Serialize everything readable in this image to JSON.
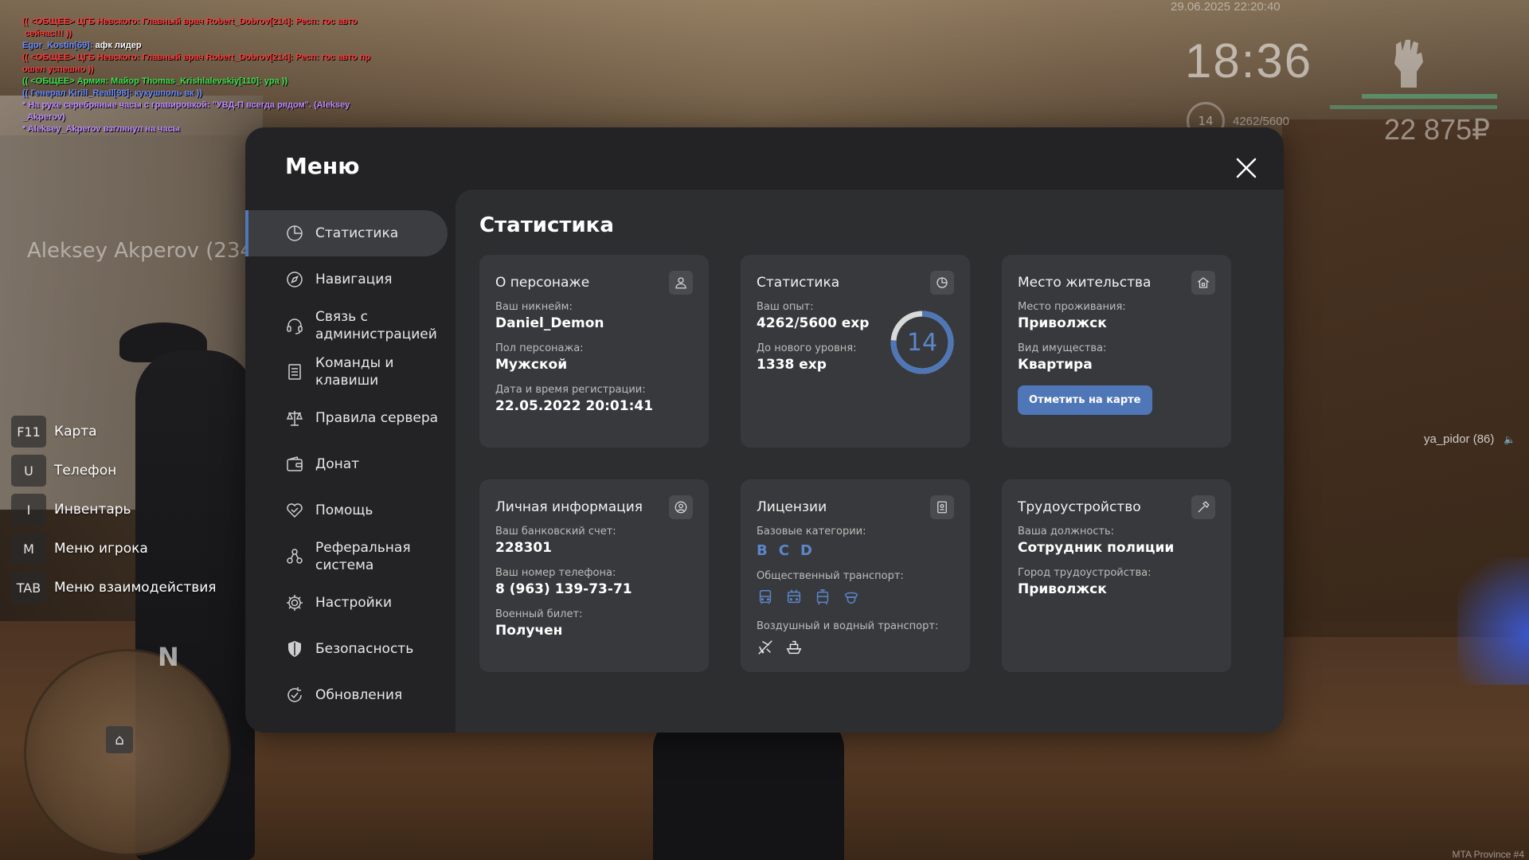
{
  "chat": [
    {
      "color": "red",
      "text": "(( <ОБЩЕЕ> ЦГБ Невского: Главный врач Robert_Dobrov[214]: Респ: гос авто\n сейчас!!! ))"
    },
    {
      "color": "blue",
      "text": "Egor_Kostin[69]:",
      "suffix": " афк лидер"
    },
    {
      "color": "red",
      "text": "(( <ОБЩЕЕ> ЦГБ Невского: Главный врач Robert_Dobrov[214]: Респ: гос авто пр\nошел успешно ))"
    },
    {
      "color": "green",
      "text": "(( <ОБЩЕЕ> Армия: Майор Thomas_Krishlalevskiy[110]: ура ))"
    },
    {
      "color": "blue",
      "text": "(( Генерал Kirill_Reall[98]: кукушполь вк ))"
    },
    {
      "color": "purple",
      "text": "* На руке серебряные часы с гравировкой: \"УВД-П всегда рядом\". (Aleksey\n_Akperov)"
    },
    {
      "color": "purple",
      "text": "* Aleksey_Akperov взглянул на часы"
    }
  ],
  "hud": {
    "datetime": "29.06.2025 22:20:40",
    "clock": "18:36",
    "money": "22 875₽",
    "level": "14",
    "exp": "4262/5600"
  },
  "nametag": "Aleksey Akperov (234",
  "player_tag": "ya_pidor (86)",
  "hints": [
    {
      "key": "F11",
      "label": "Карта"
    },
    {
      "key": "U",
      "label": "Телефон"
    },
    {
      "key": "I",
      "label": "Инвентарь"
    },
    {
      "key": "M",
      "label": "Меню игрока"
    },
    {
      "key": "TAB",
      "label": "Меню взаимодействия"
    }
  ],
  "minimap": {
    "north": "N"
  },
  "watermark": "MTA Province #4",
  "menu": {
    "title": "Меню",
    "sidebar": [
      {
        "label": "Статистика",
        "icon": "pie-chart-icon",
        "active": true
      },
      {
        "label": "Навигация",
        "icon": "compass-icon"
      },
      {
        "label": "Связь с\nадминистрацией",
        "icon": "headset-icon"
      },
      {
        "label": "Команды и\nклавиши",
        "icon": "document-list-icon"
      },
      {
        "label": "Правила сервера",
        "icon": "scales-icon"
      },
      {
        "label": "Донат",
        "icon": "wallet-icon"
      },
      {
        "label": "Помощь",
        "icon": "handshake-icon"
      },
      {
        "label": "Реферальная\nсистема",
        "icon": "people-network-icon"
      },
      {
        "label": "Настройки",
        "icon": "gear-icon"
      },
      {
        "label": "Безопасность",
        "icon": "shield-icon"
      },
      {
        "label": "Обновления",
        "icon": "refresh-check-icon"
      }
    ],
    "content_title": "Статистика",
    "cards": {
      "character": {
        "title": "О персонаже",
        "nickname_label": "Ваш никнейм:",
        "nickname": "Daniel_Demon",
        "gender_label": "Пол персонажа:",
        "gender": "Мужской",
        "reg_label": "Дата и время регистрации:",
        "reg": "22.05.2022 20:01:41"
      },
      "stats": {
        "title": "Статистика",
        "exp_label": "Ваш опыт:",
        "exp": "4262/5600 exp",
        "next_label": "До нового уровня:",
        "next": "1338 exp",
        "level": "14",
        "progress": 0.761
      },
      "residence": {
        "title": "Место жительства",
        "place_label": "Место проживания:",
        "place": "Приволжск",
        "property_label": "Вид имущества:",
        "property": "Квартира",
        "button": "Отметить на карте"
      },
      "personal": {
        "title": "Личная информация",
        "bank_label": "Ваш банковский счет:",
        "bank": "228301",
        "phone_label": "Ваш номер телефона:",
        "phone": "8 (963) 139-73-71",
        "military_label": "Военный билет:",
        "military": "Получен"
      },
      "licenses": {
        "title": "Лицензии",
        "base_label": "Базовые категории:",
        "categories": [
          "B",
          "C",
          "D"
        ],
        "public_label": "Общественный транспорт:",
        "public_icons": [
          "bus-icon",
          "trolleybus-icon",
          "tram-icon",
          "driver-cap-icon"
        ],
        "air_label": "Воздушный и водный транспорт:",
        "air_icons": [
          "airplane-icon",
          "boat-icon"
        ]
      },
      "job": {
        "title": "Трудоустройство",
        "position_label": "Ваша должность:",
        "position": "Сотрудник полиции",
        "city_label": "Город трудоустройства:",
        "city": "Приволжск"
      }
    }
  },
  "colors": {
    "accent": "#4f77b8",
    "license_blue": "#5b86c9",
    "panel": "#232325",
    "content": "#2d2e30",
    "card": "#38393c"
  }
}
